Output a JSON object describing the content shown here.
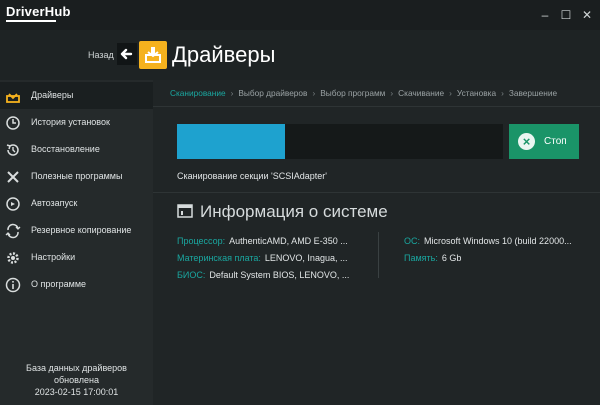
{
  "app": {
    "name": "DriverHub"
  },
  "window_controls": [
    "–",
    "☐",
    "✕"
  ],
  "header": {
    "back_label": "Назад",
    "title": "Драйверы"
  },
  "sidebar": {
    "items": [
      {
        "label": "Драйверы",
        "icon": "drivers-icon",
        "active": true
      },
      {
        "label": "История установок",
        "icon": "clock-icon",
        "active": false
      },
      {
        "label": "Восстановление",
        "icon": "restore-icon",
        "active": false
      },
      {
        "label": "Полезные программы",
        "icon": "tools-icon",
        "active": false
      },
      {
        "label": "Автозапуск",
        "icon": "power-icon",
        "active": false
      },
      {
        "label": "Резервное копирование",
        "icon": "backup-icon",
        "active": false
      },
      {
        "label": "Настройки",
        "icon": "gear-icon",
        "active": false
      },
      {
        "label": "О программе",
        "icon": "info-icon",
        "active": false
      }
    ],
    "db_line1": "База данных драйверов",
    "db_line2": "обновлена",
    "db_date": "2023-02-15 17:00:01"
  },
  "breadcrumb": [
    "Сканирование",
    "Выбор драйверов",
    "Выбор программ",
    "Скачивание",
    "Установка",
    "Завершение"
  ],
  "scan": {
    "progress_fraction": 0.33,
    "stop_label": "Стоп",
    "status": "Сканирование секции 'SCSIAdapter'"
  },
  "system_info": {
    "title": "Информация о системе",
    "cpu_label": "Процессор:",
    "cpu_value": "AuthenticAMD, AMD E-350 ...",
    "board_label": "Материнская плата:",
    "board_value": "LENOVO, Inagua, ...",
    "bios_label": "БИОС:",
    "bios_value": "Default System BIOS, LENOVO, ...",
    "os_label": "ОС:",
    "os_value": "Microsoft Windows 10 (build 22000...",
    "ram_label": "Память:",
    "ram_value": "6 Gb"
  },
  "colors": {
    "accent": "#1aa7a0",
    "progress": "#1ea2cf",
    "stop": "#1a9468",
    "drivers_icon": "#f5b21e"
  }
}
